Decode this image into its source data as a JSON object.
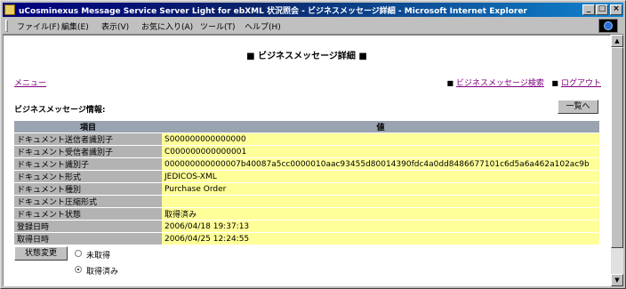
{
  "window": {
    "title": "uCosminexus Message Service Server Light for ebXML 状況照会 - ビジネスメッセージ詳細 - Microsoft Internet Explorer",
    "minimize": "_",
    "maximize": "□",
    "close": "×"
  },
  "menubar": {
    "items": [
      "ファイル(F)",
      "編集(E)",
      "表示(V)",
      "お気に入り(A)",
      "ツール(T)",
      "ヘルプ(H)"
    ]
  },
  "page": {
    "title": "■ ビジネスメッセージ詳細 ■",
    "menu_link": "メニュー",
    "search_bullet": "■",
    "search_link": "ビジネスメッセージ検索",
    "logout_bullet": "■",
    "logout_link": "ログアウト",
    "section_title": "ビジネスメッセージ情報:",
    "list_button": "一覧へ"
  },
  "table": {
    "headers": [
      "項目",
      "値"
    ],
    "rows": [
      {
        "key": "ドキュメント送信者識別子",
        "value": "S000000000000000"
      },
      {
        "key": "ドキュメント受信者識別子",
        "value": "C000000000000001"
      },
      {
        "key": "ドキュメント識別子",
        "value": "000000000000007b40087a5cc0000010aac93455d80014390fdc4a0dd8486677101c6d5a6a462a102ac9b"
      },
      {
        "key": "ドキュメント形式",
        "value": "JEDICOS-XML"
      },
      {
        "key": "ドキュメント種別",
        "value": "Purchase Order"
      },
      {
        "key": "ドキュメント圧縮形式",
        "value": ""
      },
      {
        "key": "ドキュメント状態",
        "value": "取得済み"
      },
      {
        "key": "登録日時",
        "value": "2006/04/18 19:37:13"
      },
      {
        "key": "取得日時",
        "value": "2006/04/25 12:24:55"
      }
    ]
  },
  "status": {
    "change_button": "状態変更",
    "options": [
      "未取得",
      "取得済み"
    ],
    "selected": "取得済み"
  },
  "colors": {
    "titlebar": "#0a246a",
    "header_cell": "#9aa3b0",
    "key_cell": "#b3b3b3",
    "value_cell": "#ffff99",
    "visited_link": "#800080"
  }
}
